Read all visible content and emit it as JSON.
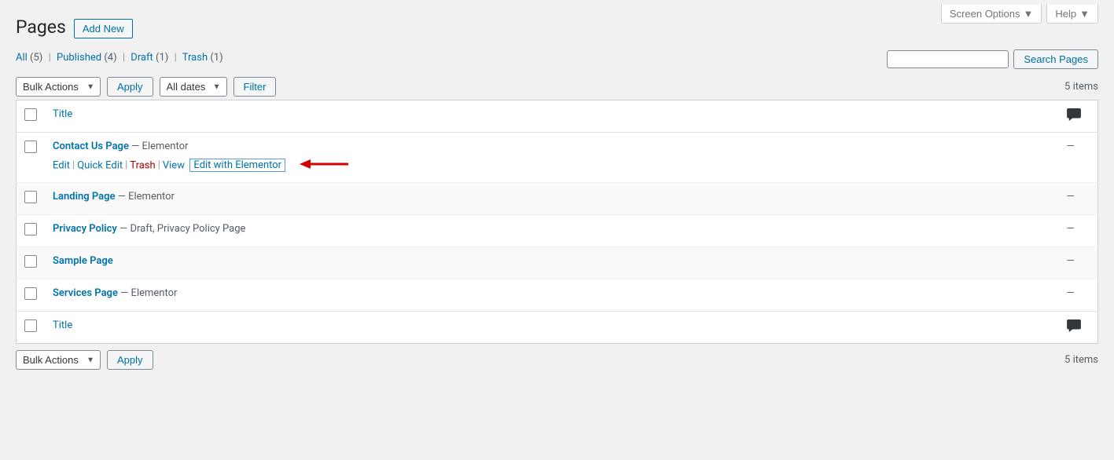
{
  "meta": {
    "screen_options": "Screen Options",
    "help": "Help"
  },
  "header": {
    "title": "Pages",
    "add_new": "Add New"
  },
  "views": {
    "all_label": "All",
    "all_count": "(5)",
    "published_label": "Published",
    "published_count": "(4)",
    "draft_label": "Draft",
    "draft_count": "(1)",
    "trash_label": "Trash",
    "trash_count": "(1)"
  },
  "search": {
    "button": "Search Pages"
  },
  "filters": {
    "bulk_action": "Bulk Actions",
    "apply": "Apply",
    "all_dates": "All dates",
    "filter": "Filter",
    "items_count": "5 items"
  },
  "columns": {
    "title": "Title"
  },
  "rows": [
    {
      "title": "Contact Us Page",
      "state": "— Elementor",
      "dash": "—",
      "show_actions": true,
      "actions": {
        "edit": "Edit",
        "quick_edit": "Quick Edit",
        "trash": "Trash",
        "view": "View",
        "elementor": "Edit with Elementor"
      }
    },
    {
      "title": "Landing Page",
      "state": "— Elementor",
      "dash": "—",
      "show_actions": false
    },
    {
      "title": "Privacy Policy",
      "state": "— Draft, Privacy Policy Page",
      "dash": "—",
      "show_actions": false
    },
    {
      "title": "Sample Page",
      "state": "",
      "dash": "—",
      "show_actions": false
    },
    {
      "title": "Services Page",
      "state": "— Elementor",
      "dash": "—",
      "show_actions": false
    }
  ],
  "footer": {
    "bulk_action": "Bulk Actions",
    "apply": "Apply",
    "items_count": "5 items"
  }
}
